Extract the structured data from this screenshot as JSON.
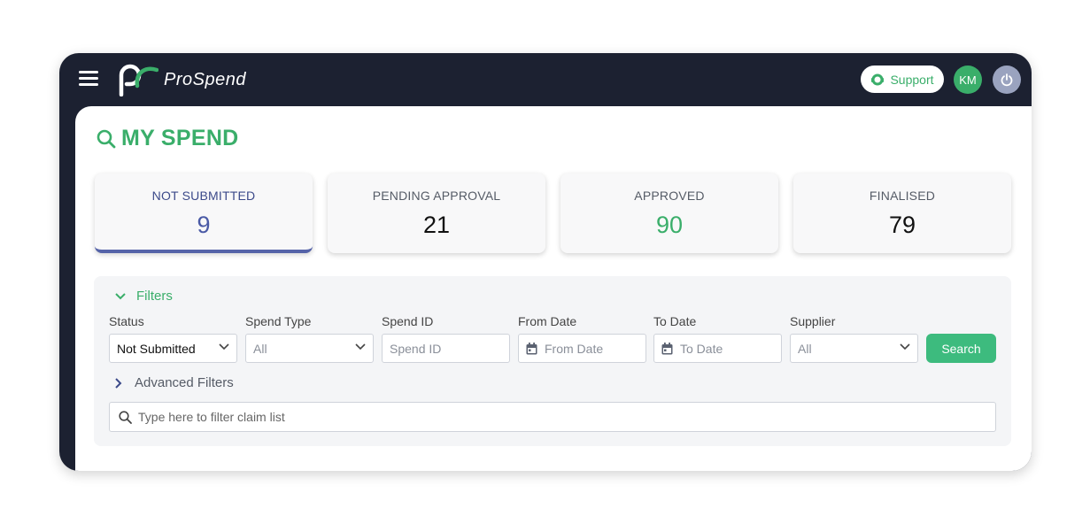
{
  "header": {
    "logo_text": "ProSpend",
    "support_label": "Support",
    "user_initials": "KM"
  },
  "page": {
    "title": "MY SPEND"
  },
  "summary_cards": [
    {
      "label": "NOT SUBMITTED",
      "value": "9"
    },
    {
      "label": "PENDING APPROVAL",
      "value": "21"
    },
    {
      "label": "APPROVED",
      "value": "90"
    },
    {
      "label": "FINALISED",
      "value": "79"
    }
  ],
  "filters": {
    "toggle_label": "Filters",
    "status": {
      "label": "Status",
      "value": "Not Submitted"
    },
    "spend_type": {
      "label": "Spend Type",
      "value": "All"
    },
    "spend_id": {
      "label": "Spend ID",
      "placeholder": "Spend ID"
    },
    "from_date": {
      "label": "From Date",
      "placeholder": "From Date"
    },
    "to_date": {
      "label": "To Date",
      "placeholder": "To Date"
    },
    "supplier": {
      "label": "Supplier",
      "value": "All"
    },
    "search_label": "Search",
    "advanced_label": "Advanced Filters",
    "claim_filter_placeholder": "Type here to filter claim list"
  },
  "colors": {
    "brand_green": "#3aae6a",
    "header_bg": "#1c2131",
    "active_blue": "#4a5aa6"
  }
}
